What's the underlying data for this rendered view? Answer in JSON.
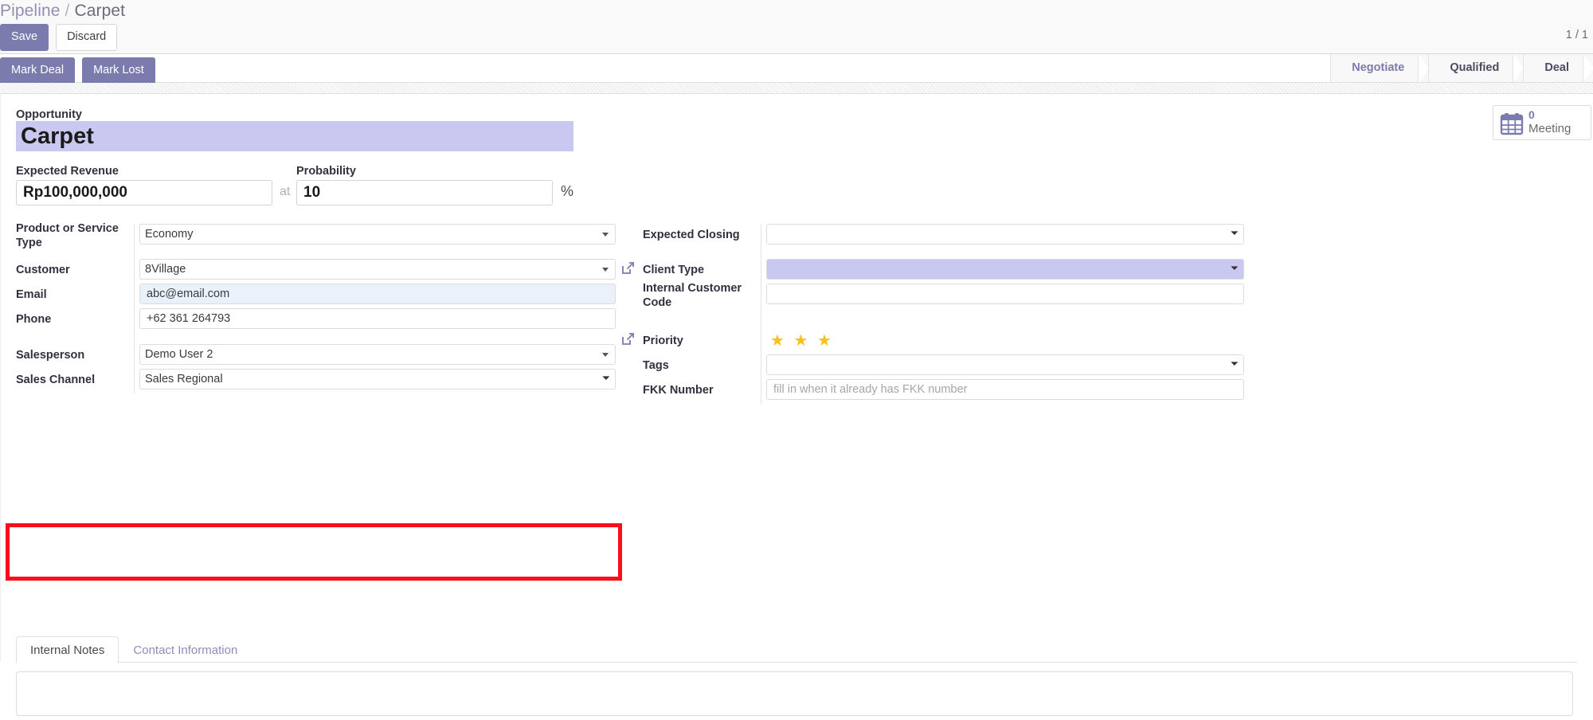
{
  "breadcrumb": {
    "parent": "Pipeline",
    "separator": "/",
    "current": "Carpet"
  },
  "toolbar": {
    "save_label": "Save",
    "discard_label": "Discard",
    "mark_deal_label": "Mark Deal",
    "mark_lost_label": "Mark Lost"
  },
  "pager": {
    "text": "1 / 1"
  },
  "statusbar": {
    "stages": [
      {
        "label": "Negotiate",
        "state": "upcoming"
      },
      {
        "label": "Qualified",
        "state": "upcoming"
      },
      {
        "label": "Deal",
        "state": "current"
      }
    ]
  },
  "smart_button": {
    "icon": "calendar-icon",
    "value": "0",
    "label": "Meeting"
  },
  "form": {
    "opportunity_label": "Opportunity",
    "opportunity_value": "Carpet",
    "expected_revenue_label": "Expected Revenue",
    "expected_revenue_value": "Rp100,000,000",
    "at_word": "at",
    "probability_label": "Probability",
    "probability_value": "10",
    "percent_word": "%",
    "left_group": [
      {
        "label": "Product or Service Type",
        "type": "select",
        "value": "Economy",
        "highlight": "none"
      },
      {
        "label": "Customer",
        "type": "select",
        "value": "8Village",
        "highlight": "none"
      },
      {
        "label": "Email",
        "type": "text",
        "value": "abc@email.com",
        "highlight": "blue"
      },
      {
        "label": "Phone",
        "type": "text",
        "value": "+62 361 264793",
        "highlight": "none"
      },
      {
        "label": "Salesperson",
        "type": "select",
        "value": "Demo User 2",
        "highlight": "none"
      },
      {
        "label": "Sales Channel",
        "type": "select",
        "value": "Sales Regional",
        "highlight": "none"
      }
    ],
    "right_group": [
      {
        "label": "Expected Closing",
        "type": "select",
        "value": "",
        "highlight": "none"
      },
      {
        "label": "Client Type",
        "type": "select",
        "value": "",
        "highlight": "violet"
      },
      {
        "label": "Internal Customer Code",
        "type": "text",
        "value": "",
        "highlight": "none"
      },
      {
        "label": "Priority",
        "type": "stars",
        "value": "★ ★ ★",
        "highlight": "none"
      },
      {
        "label": "Tags",
        "type": "select",
        "value": "",
        "highlight": "none"
      },
      {
        "label": "FKK Number",
        "type": "text",
        "value": "",
        "placeholder": "fill in when it already has FKK number",
        "highlight": "none"
      }
    ]
  },
  "notebook": {
    "tabs": [
      {
        "label": "Internal Notes",
        "active": true
      },
      {
        "label": "Contact Information",
        "active": false
      }
    ],
    "notes_value": ""
  },
  "colors": {
    "primary": "#7c7bad",
    "highlight_violet": "#c8c8f0",
    "highlight_blue": "#eaf1fb",
    "annotation_red": "#fc0d1b",
    "star_gold": "#f6c01e"
  }
}
